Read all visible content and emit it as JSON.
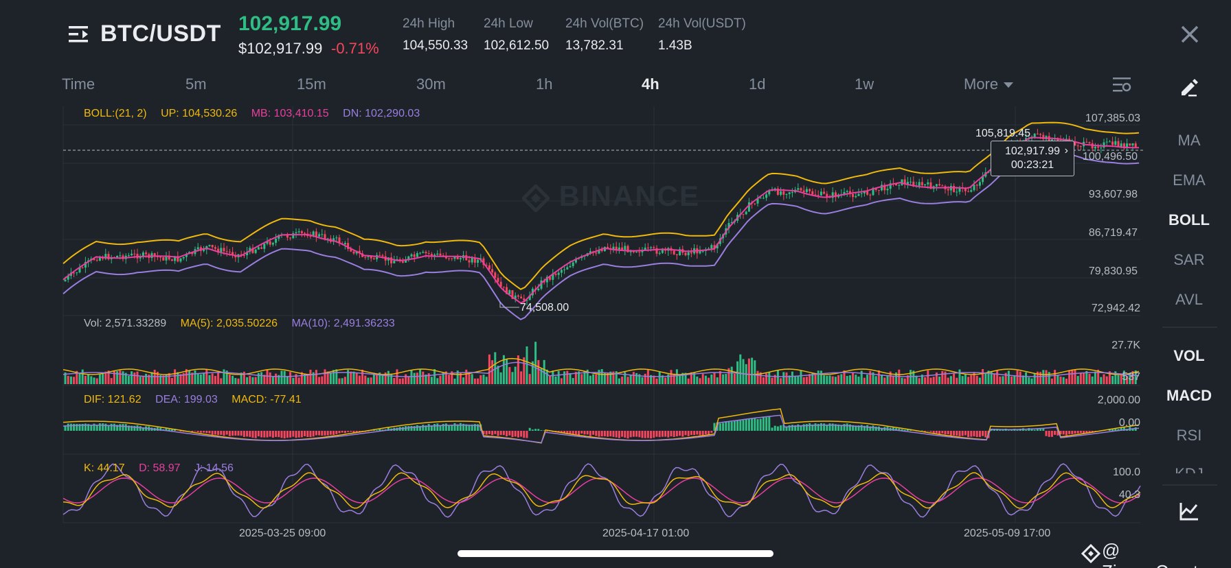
{
  "header": {
    "pair": "BTC/USDT",
    "last_price": "102,917.99",
    "usd_price": "$102,917.99",
    "change_pct": "-0.71%",
    "stats": [
      {
        "label": "24h High",
        "value": "104,550.33"
      },
      {
        "label": "24h Low",
        "value": "102,612.50"
      },
      {
        "label": "24h Vol(BTC)",
        "value": "13,782.31"
      },
      {
        "label": "24h Vol(USDT)",
        "value": "1.43B"
      }
    ]
  },
  "tabs": {
    "items": [
      "Time",
      "5m",
      "15m",
      "30m",
      "1h",
      "4h",
      "1d",
      "1w",
      "More"
    ],
    "active": "4h"
  },
  "legends": {
    "boll": {
      "label": "BOLL:(21, 2)",
      "up": "UP: 104,530.26",
      "mb": "MB: 103,410.15",
      "dn": "DN: 102,290.03"
    },
    "vol": {
      "label": "Vol: 2,571.33289",
      "ma5": "MA(5): 2,035.50226",
      "ma10": "MA(10): 2,491.36233"
    },
    "macd": {
      "dif": "DIF: 121.62",
      "dea": "DEA: 199.03",
      "macd": "MACD: -77.41"
    },
    "kdj": {
      "k": "K: 44.17",
      "d": "D: 58.97",
      "j": "J: 14.56"
    }
  },
  "y_axis": {
    "price": [
      "107,385.03",
      "100,496.50",
      "93,607.98",
      "86,719.47",
      "79,830.95",
      "72,942.42"
    ],
    "volume": [
      "27.7K",
      "537"
    ],
    "macd": [
      "2,000.00",
      "0.00"
    ],
    "kdj": [
      "100.0",
      "40.3"
    ]
  },
  "x_axis": [
    "2025-03-25 09:00",
    "2025-04-17 01:00",
    "2025-05-09 17:00"
  ],
  "annotations": {
    "high": "105,819.45",
    "low": "74,508.00",
    "tooltip_price": "102,917.99",
    "tooltip_countdown": "00:23:21",
    "tooltip_arrow": "›"
  },
  "watermark": "BINANCE",
  "side_panel": {
    "main": [
      "MA",
      "EMA",
      "BOLL",
      "SAR",
      "AVL"
    ],
    "main_active": "BOLL",
    "sub": [
      "VOL",
      "MACD",
      "RSI",
      "KDJ"
    ],
    "sub_active": [
      "VOL",
      "MACD"
    ]
  },
  "credit": "@ Zizou_Crypto",
  "colors": {
    "background": "#1e2329",
    "up": "#2ebd85",
    "down": "#f6465d",
    "yellow": "#f0b90b",
    "pink": "#e93fa0",
    "purple": "#9b7fe0",
    "muted": "#848e9c",
    "grid": "#2b3139"
  },
  "icons": {
    "menu": "menu-icon",
    "close": "close-icon",
    "settings": "chart-settings-icon",
    "edit": "draw-tool-icon",
    "indicator": "indicator-chart-icon",
    "binance": "binance-logo-icon"
  }
}
